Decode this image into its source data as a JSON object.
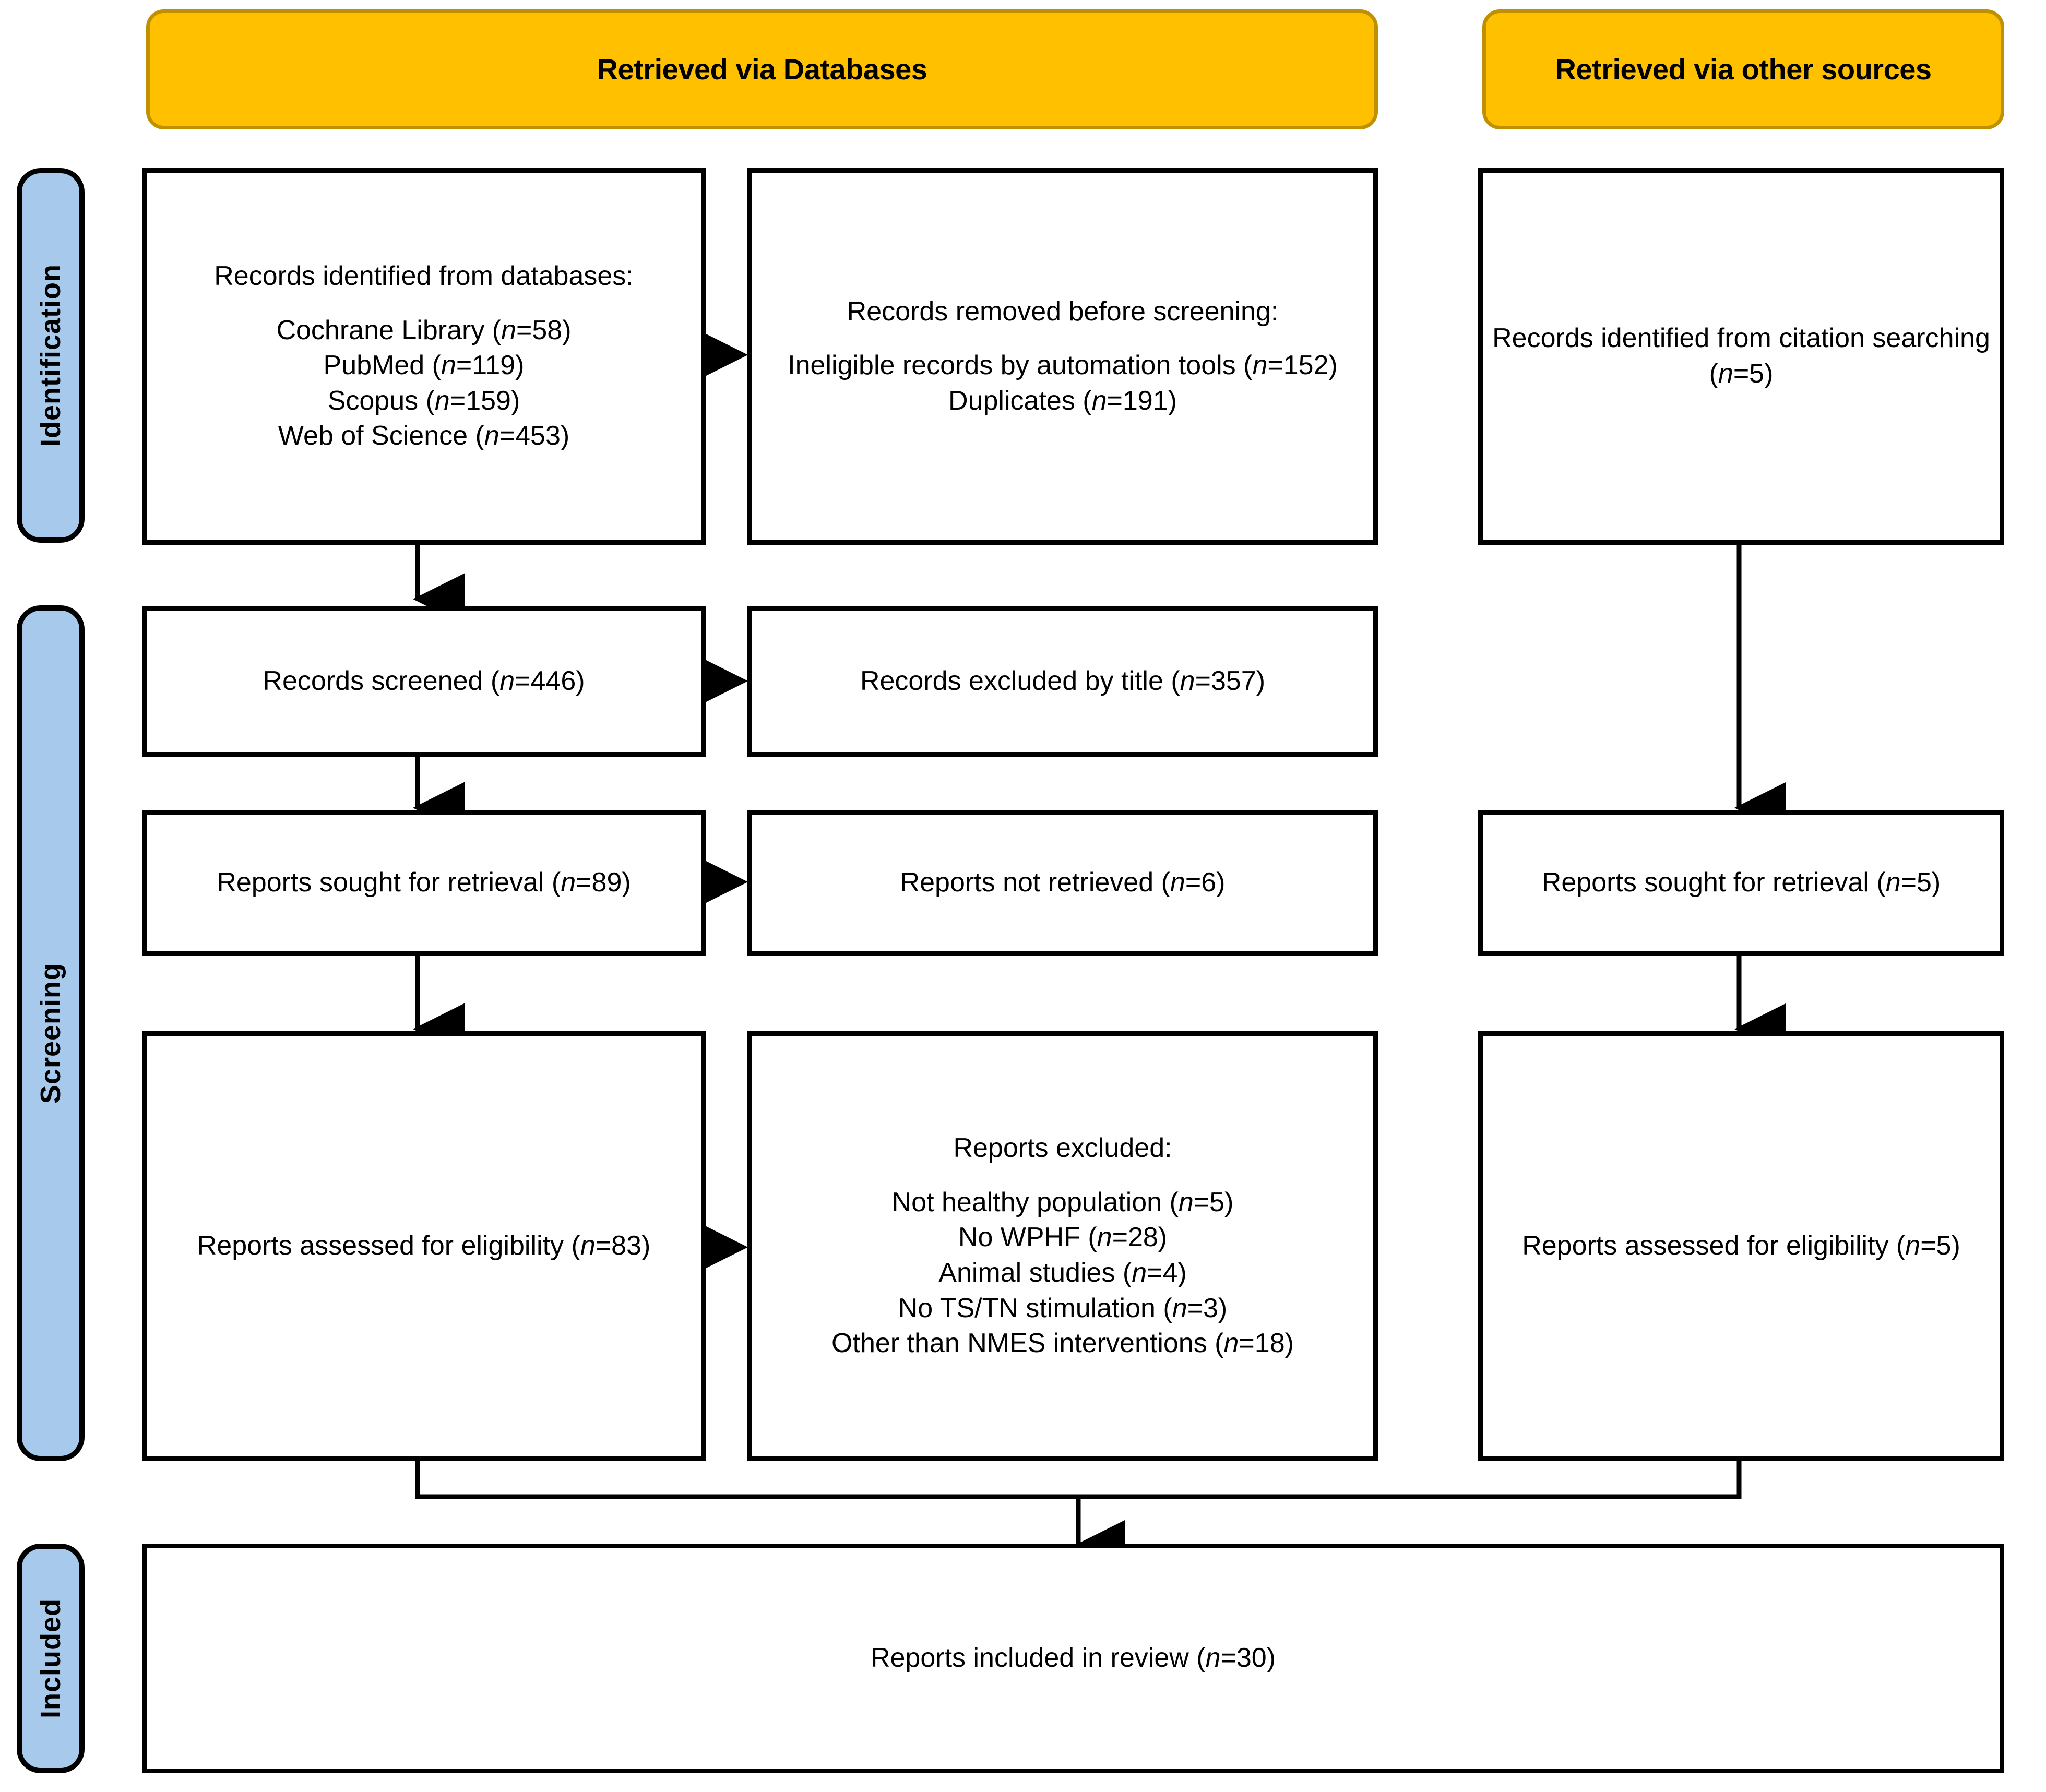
{
  "title": "PRISMA 2020 flow diagram",
  "colors": {
    "banner_fill": "#FFC000",
    "banner_border": "#BF9000",
    "stage_tab_fill": "#A6C9EC",
    "box_border": "#000000",
    "background": "#FFFFFF"
  },
  "banners": {
    "databases": "Retrieved via Databases",
    "other_sources": "Retrieved via other sources"
  },
  "stages": {
    "identification": "Identification",
    "screening": "Screening",
    "included": "Included"
  },
  "boxes": {
    "records_identified": {
      "heading": "Records identified from databases:",
      "items": [
        "Cochrane Library (n=58)",
        "PubMed (n=119)",
        "Scopus (n=159)",
        "Web of Science (n=453)"
      ]
    },
    "records_removed": {
      "heading": "Records removed before screening:",
      "items": [
        "Ineligible records by automation tools (n=152)",
        "Duplicates (n=191)"
      ]
    },
    "other_identified": {
      "text": "Records identified from citation searching (n=5)"
    },
    "records_screened": {
      "text": "Records screened (n=446)"
    },
    "records_excluded_title": {
      "text": "Records excluded by title (n=357)"
    },
    "reports_sought": {
      "text": "Reports sought for retrieval (n=89)"
    },
    "reports_not_retrieved": {
      "text": "Reports not retrieved (n=6)"
    },
    "reports_assessed": {
      "text": "Reports assessed for eligibility (n=83)"
    },
    "reports_excluded": {
      "heading": "Reports excluded:",
      "items": [
        "Not healthy population (n=5)",
        "No WPHF (n=28)",
        "Animal studies (n=4)",
        "No TS/TN stimulation (n=3)",
        "Other than NMES interventions (n=18)"
      ]
    },
    "other_reports_sought": {
      "text": "Reports sought for retrieval (n=5)"
    },
    "other_reports_assessed": {
      "text": "Reports assessed for eligibility (n=5)"
    },
    "reports_included": {
      "text": "Reports included in review (n=30)"
    }
  },
  "chart_data": {
    "type": "table",
    "title": "PRISMA 2020 flow diagram",
    "counts": {
      "cochrane_library": 58,
      "pubmed": 119,
      "scopus": 159,
      "web_of_science": 453,
      "ineligible_by_automation_tools": 152,
      "duplicates": 191,
      "citation_searching": 5,
      "records_screened": 446,
      "records_excluded_by_title": 357,
      "reports_sought_for_retrieval_db": 89,
      "reports_not_retrieved": 6,
      "reports_assessed_for_eligibility_db": 83,
      "excluded_not_healthy_population": 5,
      "excluded_no_wphf": 28,
      "excluded_animal_studies": 4,
      "excluded_no_ts_tn_stimulation": 3,
      "excluded_other_than_nmes_interventions": 18,
      "reports_sought_for_retrieval_other": 5,
      "reports_assessed_for_eligibility_other": 5,
      "reports_included_in_review": 30
    }
  }
}
